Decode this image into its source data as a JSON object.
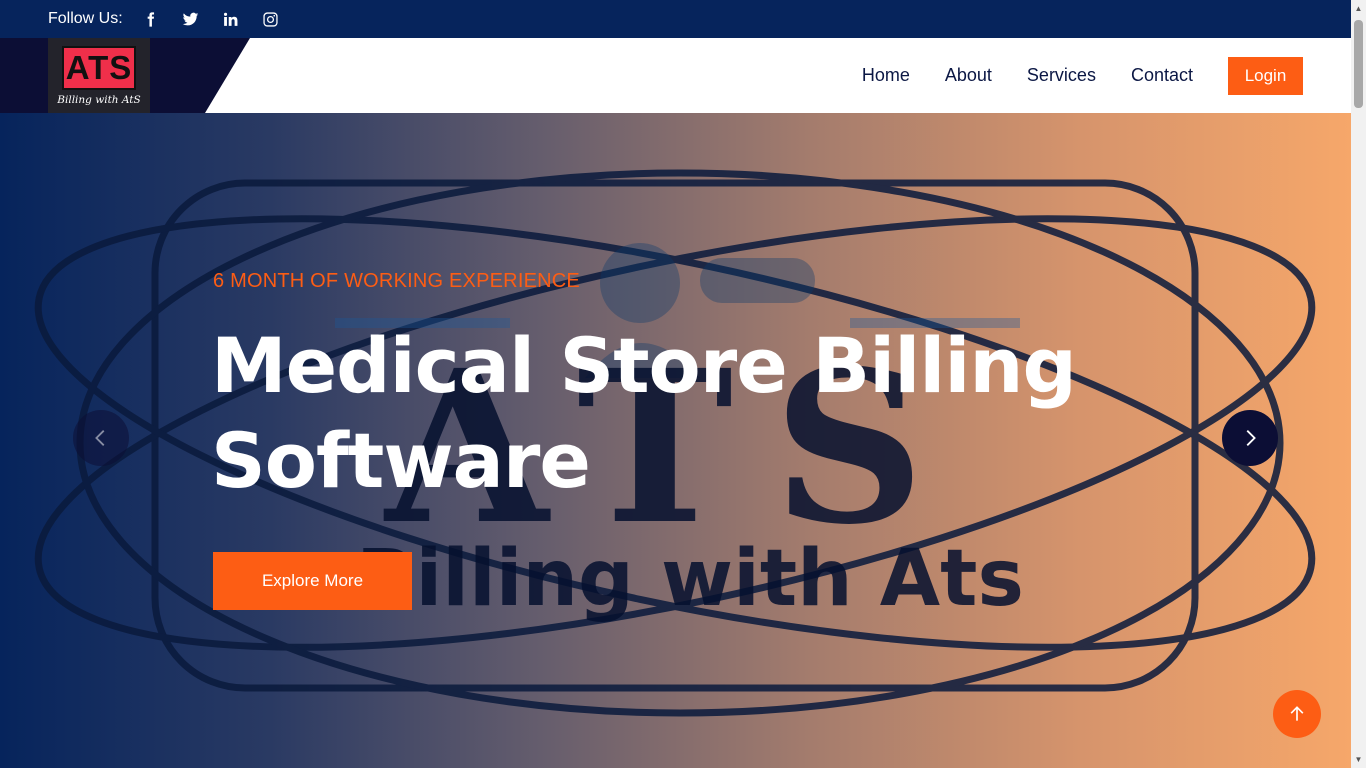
{
  "topbar": {
    "follow_label": "Follow Us:",
    "socials": [
      {
        "name": "facebook-icon"
      },
      {
        "name": "twitter-icon"
      },
      {
        "name": "linkedin-icon"
      },
      {
        "name": "instagram-icon"
      }
    ]
  },
  "brand": {
    "logo_text": "ATS",
    "logo_tagline": "Billing with AtS"
  },
  "nav": {
    "items": [
      "Home",
      "About",
      "Services",
      "Contact"
    ],
    "login_label": "Login"
  },
  "hero": {
    "eyebrow": "6 MONTH OF WORKING EXPERIENCE",
    "title": "Medical Store Billing Software",
    "cta_label": "Explore More",
    "background_watermark": {
      "line1": "ATS",
      "line2": "Billing with Ats"
    }
  },
  "colors": {
    "topbar": "#06245c",
    "accent": "#fd5d14",
    "nav_text": "#0b1744",
    "dark": "#0c0e35"
  },
  "icons": {
    "prev": "chevron-left-icon",
    "next": "chevron-right-icon",
    "back_to_top": "arrow-up-icon"
  }
}
